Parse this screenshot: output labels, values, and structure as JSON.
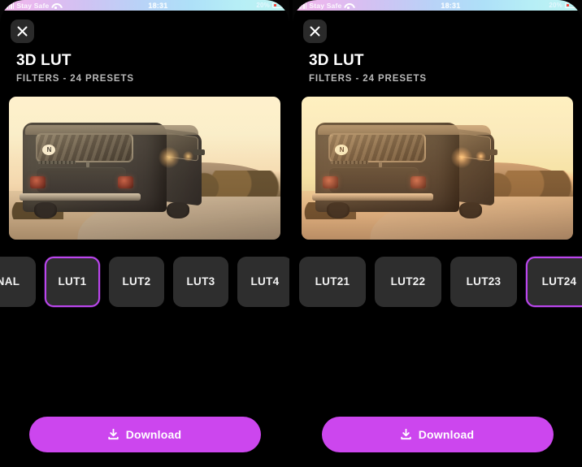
{
  "panels": [
    {
      "status": {
        "carrier": "Stay Safe",
        "time": "18:31",
        "battery_pct": "20%",
        "signal_icon": "signal-bars-icon",
        "wifi_icon": "wifi-icon",
        "battery_icon": "battery-low-icon"
      },
      "close_icon": "close-icon",
      "title": "3D LUT",
      "subtitle": "FILTERS - 24 PRESETS",
      "preview": {
        "alt": "VW bus on desert road, warm LUT preview",
        "badge": "N"
      },
      "presets": [
        {
          "label": "NAL",
          "selected": false,
          "partial": true,
          "sliver": false
        },
        {
          "label": "LUT1",
          "selected": true,
          "partial": false,
          "sliver": false
        },
        {
          "label": "LUT2",
          "selected": false,
          "partial": false,
          "sliver": false
        },
        {
          "label": "LUT3",
          "selected": false,
          "partial": false,
          "sliver": false
        },
        {
          "label": "LUT4",
          "selected": false,
          "partial": false,
          "sliver": false
        }
      ],
      "download_label": "Download",
      "download_icon": "download-icon"
    },
    {
      "status": {
        "carrier": "Stay Safe",
        "time": "18:31",
        "battery_pct": "20%",
        "signal_icon": "signal-bars-icon",
        "wifi_icon": "wifi-icon",
        "battery_icon": "battery-low-icon"
      },
      "close_icon": "close-icon",
      "title": "3D LUT",
      "subtitle": "FILTERS - 24 PRESETS",
      "preview": {
        "alt": "VW bus on desert road, amber LUT preview",
        "badge": "N"
      },
      "presets": [
        {
          "label": "",
          "selected": false,
          "partial": false,
          "sliver": true
        },
        {
          "label": "LUT21",
          "selected": false,
          "partial": false,
          "sliver": false
        },
        {
          "label": "LUT22",
          "selected": false,
          "partial": false,
          "sliver": false
        },
        {
          "label": "LUT23",
          "selected": false,
          "partial": false,
          "sliver": false
        },
        {
          "label": "LUT24",
          "selected": true,
          "partial": false,
          "sliver": false
        }
      ],
      "download_label": "Download",
      "download_icon": "download-icon"
    }
  ],
  "colors": {
    "accent": "#cc46ee",
    "selected_border": "#bb46ee",
    "chip_bg": "#2e2e2e",
    "background": "#000000",
    "title_text": "#ffffff",
    "subtitle_text": "#b9b9b9",
    "battery_low": "#ff3b30"
  }
}
